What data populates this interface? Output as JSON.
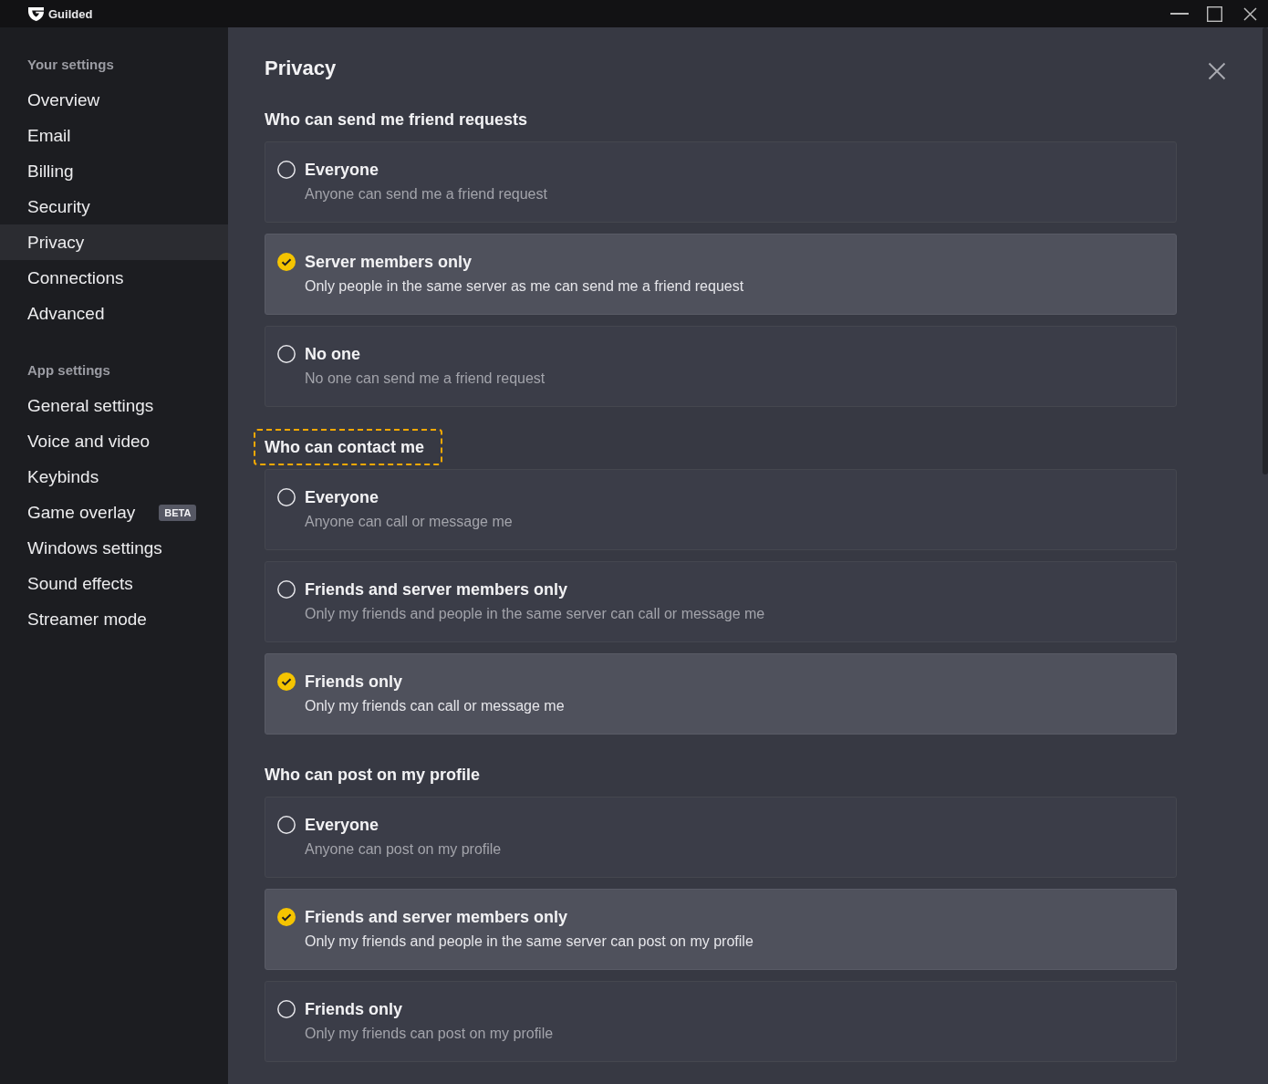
{
  "window": {
    "title": "Guilded"
  },
  "sidebar": {
    "groups": [
      {
        "header": "Your settings",
        "items": [
          {
            "label": "Overview",
            "selected": false
          },
          {
            "label": "Email",
            "selected": false
          },
          {
            "label": "Billing",
            "selected": false
          },
          {
            "label": "Security",
            "selected": false
          },
          {
            "label": "Privacy",
            "selected": true
          },
          {
            "label": "Connections",
            "selected": false
          },
          {
            "label": "Advanced",
            "selected": false
          }
        ]
      },
      {
        "header": "App settings",
        "items": [
          {
            "label": "General settings",
            "selected": false
          },
          {
            "label": "Voice and video",
            "selected": false
          },
          {
            "label": "Keybinds",
            "selected": false
          },
          {
            "label": "Game overlay",
            "selected": false,
            "badge": "BETA"
          },
          {
            "label": "Windows settings",
            "selected": false
          },
          {
            "label": "Sound effects",
            "selected": false
          },
          {
            "label": "Streamer mode",
            "selected": false
          }
        ]
      }
    ]
  },
  "page": {
    "title": "Privacy",
    "sections": [
      {
        "heading": "Who can send me friend requests",
        "focused": false,
        "options": [
          {
            "label": "Everyone",
            "description": "Anyone can send me a friend request",
            "selected": false
          },
          {
            "label": "Server members only",
            "description": "Only people in the same server as me can send me a friend request",
            "selected": true
          },
          {
            "label": "No one",
            "description": "No one can send me a friend request",
            "selected": false
          }
        ]
      },
      {
        "heading": "Who can contact me",
        "focused": true,
        "options": [
          {
            "label": "Everyone",
            "description": "Anyone can call or message me",
            "selected": false
          },
          {
            "label": "Friends and server members only",
            "description": "Only my friends and people in the same server can call or message me",
            "selected": false
          },
          {
            "label": "Friends only",
            "description": "Only my friends can call or message me",
            "selected": true
          }
        ]
      },
      {
        "heading": "Who can post on my profile",
        "focused": false,
        "options": [
          {
            "label": "Everyone",
            "description": "Anyone can post on my profile",
            "selected": false
          },
          {
            "label": "Friends and server members only",
            "description": "Only my friends and people in the same server can post on my profile",
            "selected": true
          },
          {
            "label": "Friends only",
            "description": "Only my friends can post on my profile",
            "selected": false
          }
        ]
      }
    ]
  }
}
